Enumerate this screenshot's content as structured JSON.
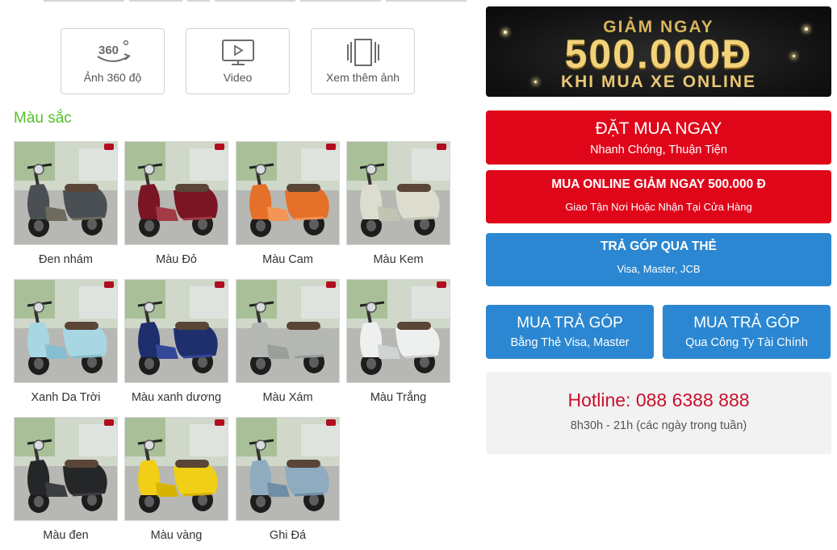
{
  "media": {
    "items": [
      {
        "label": "Ảnh 360 độ",
        "icon": "rotate-360-icon",
        "icon_text": "360"
      },
      {
        "label": "Video",
        "icon": "video-play-icon"
      },
      {
        "label": "Xem thêm ảnh",
        "icon": "gallery-icon"
      }
    ]
  },
  "colors_section": {
    "title": "Màu sắc",
    "swatches": [
      {
        "name": "Đen nhám",
        "body": "#4a4f54",
        "accent": "#6e6a5e"
      },
      {
        "name": "Màu Đỏ",
        "body": "#7a1524",
        "accent": "#a33b44"
      },
      {
        "name": "Màu Cam",
        "body": "#e5702a",
        "accent": "#f29556"
      },
      {
        "name": "Màu Kem",
        "body": "#dcdccf",
        "accent": "#c2c4b2"
      },
      {
        "name": "Xanh Da Trời",
        "body": "#a8d6e2",
        "accent": "#86bfcf"
      },
      {
        "name": "Màu xanh dương",
        "body": "#1f2f6e",
        "accent": "#34489a"
      },
      {
        "name": "Màu Xám",
        "body": "#b3b8b4",
        "accent": "#999f9b"
      },
      {
        "name": "Màu Trắng",
        "body": "#eef0ef",
        "accent": "#cfd4d3"
      },
      {
        "name": "Màu đen",
        "body": "#242628",
        "accent": "#3b3d40"
      },
      {
        "name": "Màu vàng",
        "body": "#f0cf16",
        "accent": "#d7b404"
      },
      {
        "name": "Ghi Đá",
        "body": "#8eabc0",
        "accent": "#6f8ea5"
      }
    ]
  },
  "promo": {
    "line1": "GIẢM NGAY",
    "line2": "500.000Đ",
    "line3": "KHI MUA XE ONLINE"
  },
  "actions": {
    "order_now": {
      "title": "ĐẶT MUA NGAY",
      "subtitle": "Nhanh Chóng, Thuận Tiện"
    },
    "buy_online": {
      "title": "MUA ONLINE GIẢM NGAY 500.000 Đ",
      "subtitle": "Giao Tận Nơi Hoặc Nhận Tại Cửa Hàng"
    },
    "card_installment": {
      "title": "TRẢ GÓP QUA THẺ",
      "subtitle": "Visa, Master, JCB"
    },
    "installment_card": {
      "title": "MUA TRẢ GÓP",
      "subtitle": "Bằng Thẻ Visa, Master"
    },
    "installment_finance": {
      "title": "MUA TRẢ GÓP",
      "subtitle": "Qua Công Ty Tài Chính"
    }
  },
  "contact": {
    "hotline": "Hotline: 088 6388 888",
    "hours": "8h30h - 21h (các ngày trong tuần)"
  },
  "theme": {
    "green": "#56c22a",
    "red": "#e0061a",
    "blue": "#2b87d1",
    "hotline_red": "#c8102e"
  }
}
